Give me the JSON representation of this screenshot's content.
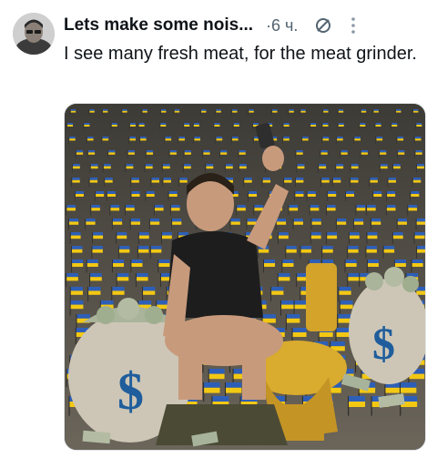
{
  "post": {
    "author_name": "Lets make some nois...",
    "time": "6 ч.",
    "separator": "·",
    "text": "I see many fresh meat, for the meat grinder."
  },
  "colors": {
    "text_primary": "#0f1419",
    "text_secondary": "#536471",
    "flag_blue": "#2e5fb8",
    "flag_yellow": "#f3c813"
  },
  "icons": {
    "mute": "mute-icon",
    "more": "more-vertical-icon",
    "money": "dollar-sign-icon"
  },
  "media": {
    "money_bag_left_symbol": "$",
    "money_bag_right_symbol": "$"
  }
}
